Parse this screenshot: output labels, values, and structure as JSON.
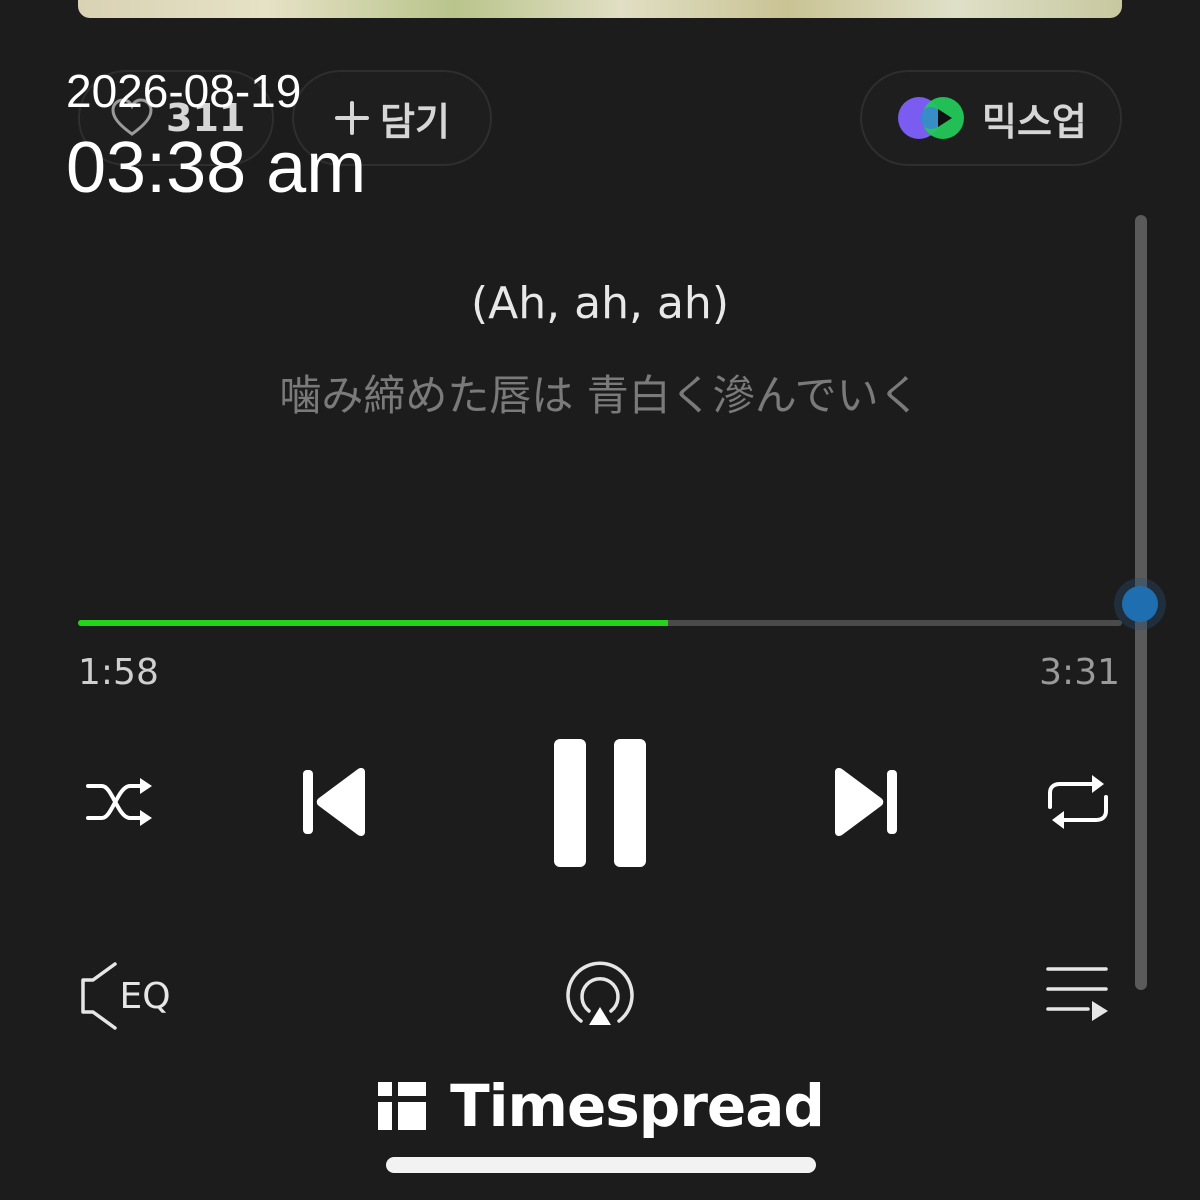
{
  "timestamp": {
    "date": "2026-08-19",
    "time": "03:38 am"
  },
  "actions": {
    "like_count": "311",
    "add_label": "담기",
    "mixup_label": "믹스업"
  },
  "lyrics": {
    "current_line": "(Ah, ah, ah)",
    "next_line": "噛み締めた唇は 青白く滲んでいく"
  },
  "playback": {
    "elapsed": "1:58",
    "total": "3:31",
    "progress_fraction": 0.565,
    "accent_color": "#22d41a"
  },
  "icons": {
    "like": "heart-icon",
    "add": "plus-icon",
    "mixup": "mixup-icon",
    "shuffle": "shuffle-icon",
    "previous": "skip-previous-icon",
    "pause": "pause-icon",
    "next": "skip-next-icon",
    "repeat": "repeat-icon",
    "equalizer": "eq-icon",
    "airplay": "airplay-icon",
    "queue": "playlist-icon"
  },
  "equalizer_label": "EQ",
  "brand": {
    "name": "Timespread"
  }
}
